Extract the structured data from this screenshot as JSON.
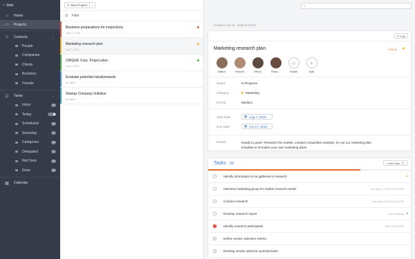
{
  "sidebar": {
    "back_label": "Start",
    "home_label": "Home",
    "projects_label": "Projects",
    "contacts_label": "Contacts",
    "contacts_items": [
      "People",
      "Companies",
      "Clients",
      "Business",
      "Friends"
    ],
    "tasks_label": "Tasks",
    "tasks_items": [
      {
        "label": "Inbox",
        "count": "10"
      },
      {
        "label": "Today",
        "count": ""
      },
      {
        "label": "Scheduled",
        "count": "10"
      },
      {
        "label": "Someday",
        "count": "3"
      },
      {
        "label": "Categories",
        "count": "10"
      },
      {
        "label": "Delegated",
        "count": "4"
      },
      {
        "label": "Not Done",
        "count": "10"
      },
      {
        "label": "Done",
        "count": "10"
      }
    ],
    "calendar_label": "Calendar"
  },
  "list": {
    "new_project_label": "New Project",
    "filter_label": "Filter",
    "projects": [
      {
        "title": "Business preparations for inspections",
        "date": "May 12, 2018",
        "color": "#e15d4d",
        "marker": "#e15d4d"
      },
      {
        "title": "Marketing research plan",
        "date": "Aug 7, 2018",
        "color": "#f1b53a",
        "marker": "#f1b53a"
      },
      {
        "title": "UNIQUE Corp. Project plan",
        "date": "May 3, 2018",
        "color": "#4caf50",
        "marker": "#4caf50"
      },
      {
        "title": "Evaluate potential risks&rewards",
        "date": "No dates",
        "color": "#4a90d9",
        "marker": ""
      },
      {
        "title": "Startup Company Initiative",
        "date": "No dates",
        "color": "#3aa8c1",
        "marker": ""
      }
    ]
  },
  "detail": {
    "search_placeholder": "",
    "created": "Created: Apr 11, 2018 at 23:57",
    "edit_label": "Edit",
    "title": "Marketing research plan",
    "tag": "LTB 90",
    "people": [
      {
        "name": "Arthur",
        "color": "#8a6d5a"
      },
      {
        "name": "Hannel",
        "color": "#b08c77"
      },
      {
        "name": "Henry",
        "color": "#5c4b3f"
      },
      {
        "name": "Rosa...",
        "color": "#6b4a3e"
      },
      {
        "name": "Susan",
        "color": ""
      },
      {
        "name": "Add",
        "color": ""
      }
    ],
    "fields": {
      "status_label": "Status",
      "status_value": "In Progress",
      "category_label": "Category",
      "category_value": "Marketing",
      "priority_label": "Priority",
      "priority_value": "Medium",
      "start_label": "Start Date",
      "start_value": "Aug 7, 2018",
      "due_label": "Due Date",
      "due_value": "Oct 17, 2018",
      "details_label": "Details",
      "details_value": "Ready to grow? Research the market, conduct competitive analysis, try out our marketing plan template to formalize your own marketing plans."
    },
    "tasks_title": "Tasks",
    "tasks_badge": "16",
    "add_task_label": "Add Task",
    "progress_fraction": 0.75,
    "tasks": [
      {
        "name": "Identify information to be gathered in research",
        "date": "",
        "state": "open",
        "marker": "#f1b53a"
      },
      {
        "name": "Interview marketing group for market research needs",
        "date": "Due Aug 17, 2018 at 12:45 PM",
        "state": "open",
        "marker": ""
      },
      {
        "name": "Conduct research",
        "date": "Due Aug 24, 2018 at 2:00 PM",
        "state": "open",
        "marker": ""
      },
      {
        "name": "Develop research report",
        "date": "Due Someday",
        "state": "open",
        "marker": "#4caf50"
      },
      {
        "name": "Identify research participants",
        "date": "Start at 12:00 PM",
        "state": "red",
        "marker": ""
      },
      {
        "name": "Define vendor selection criteria",
        "date": "",
        "state": "done",
        "marker": ""
      },
      {
        "name": "Develop vendor selection questionnaire",
        "date": "",
        "state": "done",
        "marker": ""
      }
    ]
  }
}
